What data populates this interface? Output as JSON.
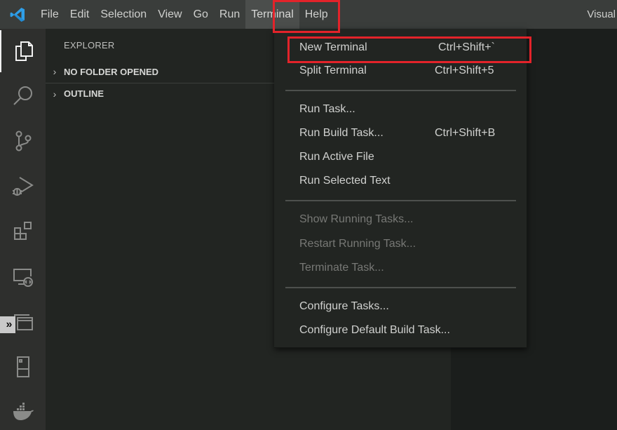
{
  "app": {
    "title_fragment": "Visual",
    "logo_icon": "vscode-logo-icon"
  },
  "menubar": {
    "items": [
      {
        "label": "File"
      },
      {
        "label": "Edit"
      },
      {
        "label": "Selection"
      },
      {
        "label": "View"
      },
      {
        "label": "Go"
      },
      {
        "label": "Run"
      },
      {
        "label": "Terminal",
        "active": true
      },
      {
        "label": "Help"
      }
    ]
  },
  "activitybar": {
    "items": [
      {
        "name": "explorer",
        "icon": "files-icon",
        "active": true
      },
      {
        "name": "search",
        "icon": "search-icon"
      },
      {
        "name": "source-control",
        "icon": "source-control-icon"
      },
      {
        "name": "run-and-debug",
        "icon": "run-debug-icon"
      },
      {
        "name": "extensions",
        "icon": "extensions-icon"
      },
      {
        "name": "remote-explorer",
        "icon": "remote-explorer-icon"
      },
      {
        "name": "panel",
        "icon": "window-panel-icon"
      },
      {
        "name": "device",
        "icon": "device-icon"
      },
      {
        "name": "docker",
        "icon": "docker-icon"
      }
    ],
    "collapse_glyph": "»"
  },
  "sidebar": {
    "title": "EXPLORER",
    "sections": [
      {
        "label": "NO FOLDER OPENED",
        "chevron": "›"
      },
      {
        "label": "OUTLINE",
        "chevron": "›"
      }
    ]
  },
  "terminal_menu": {
    "groups": [
      [
        {
          "label": "New Terminal",
          "shortcut": "Ctrl+Shift+`",
          "highlighted": true
        },
        {
          "label": "Split Terminal",
          "shortcut": "Ctrl+Shift+5"
        }
      ],
      [
        {
          "label": "Run Task...",
          "shortcut": ""
        },
        {
          "label": "Run Build Task...",
          "shortcut": "Ctrl+Shift+B"
        },
        {
          "label": "Run Active File",
          "shortcut": ""
        },
        {
          "label": "Run Selected Text",
          "shortcut": ""
        }
      ],
      [
        {
          "label": "Show Running Tasks...",
          "shortcut": "",
          "disabled": true
        },
        {
          "label": "Restart Running Task...",
          "shortcut": "",
          "disabled": true
        },
        {
          "label": "Terminate Task...",
          "shortcut": "",
          "disabled": true
        }
      ],
      [
        {
          "label": "Configure Tasks...",
          "shortcut": ""
        },
        {
          "label": "Configure Default Build Task...",
          "shortcut": ""
        }
      ]
    ]
  },
  "colors": {
    "annotation_red": "#e3232a",
    "vscode_blue": "#2f9fe8"
  }
}
